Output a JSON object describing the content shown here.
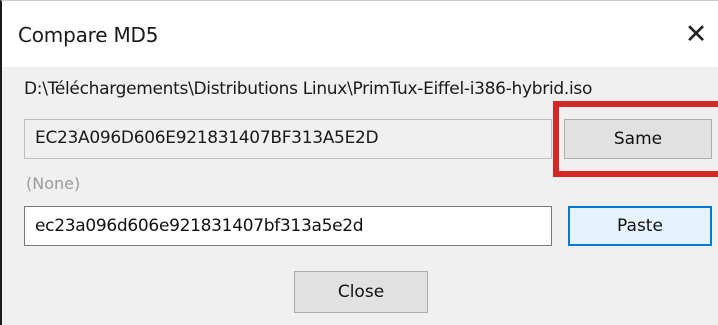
{
  "window": {
    "title": "Compare MD5",
    "close_glyph": "✕"
  },
  "file": {
    "path": "D:\\Téléchargements\\Distributions Linux\\PrimTux-Eiffel-i386-hybrid.iso"
  },
  "computed_md5": {
    "value": "EC23A096D606E921831407BF313A5E2D"
  },
  "compare": {
    "status_label": "(None)",
    "input_value": "ec23a096d606e921831407bf313a5e2d"
  },
  "buttons": {
    "same_label": "Same",
    "paste_label": "Paste",
    "close_label": "Close"
  },
  "colors": {
    "highlight": "#d42727",
    "focus_accent": "#0078d7"
  },
  "icons": {
    "close": "close-icon"
  }
}
